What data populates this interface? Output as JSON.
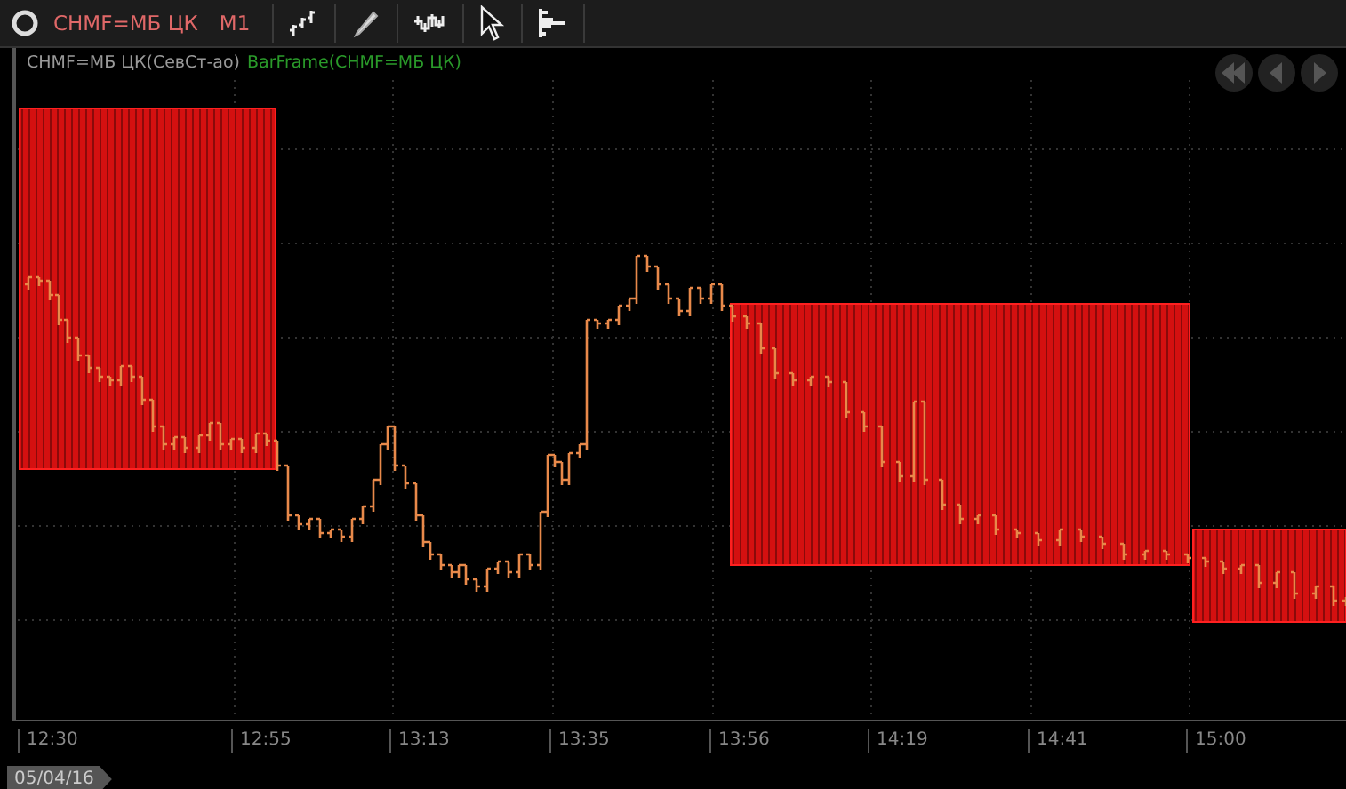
{
  "toolbar": {
    "instrument": "CHMF=МБ ЦК",
    "timeframe": "M1"
  },
  "legend": {
    "series": "CHMF=МБ ЦК(СевСт-ао)",
    "indicator": "BarFrame(CHMF=МБ ЦК)"
  },
  "x_axis": {
    "labels": [
      "12:30",
      "12:55",
      "13:13",
      "13:35",
      "13:56",
      "14:19",
      "14:41",
      "15:00"
    ]
  },
  "date_label": "05/04/16"
}
